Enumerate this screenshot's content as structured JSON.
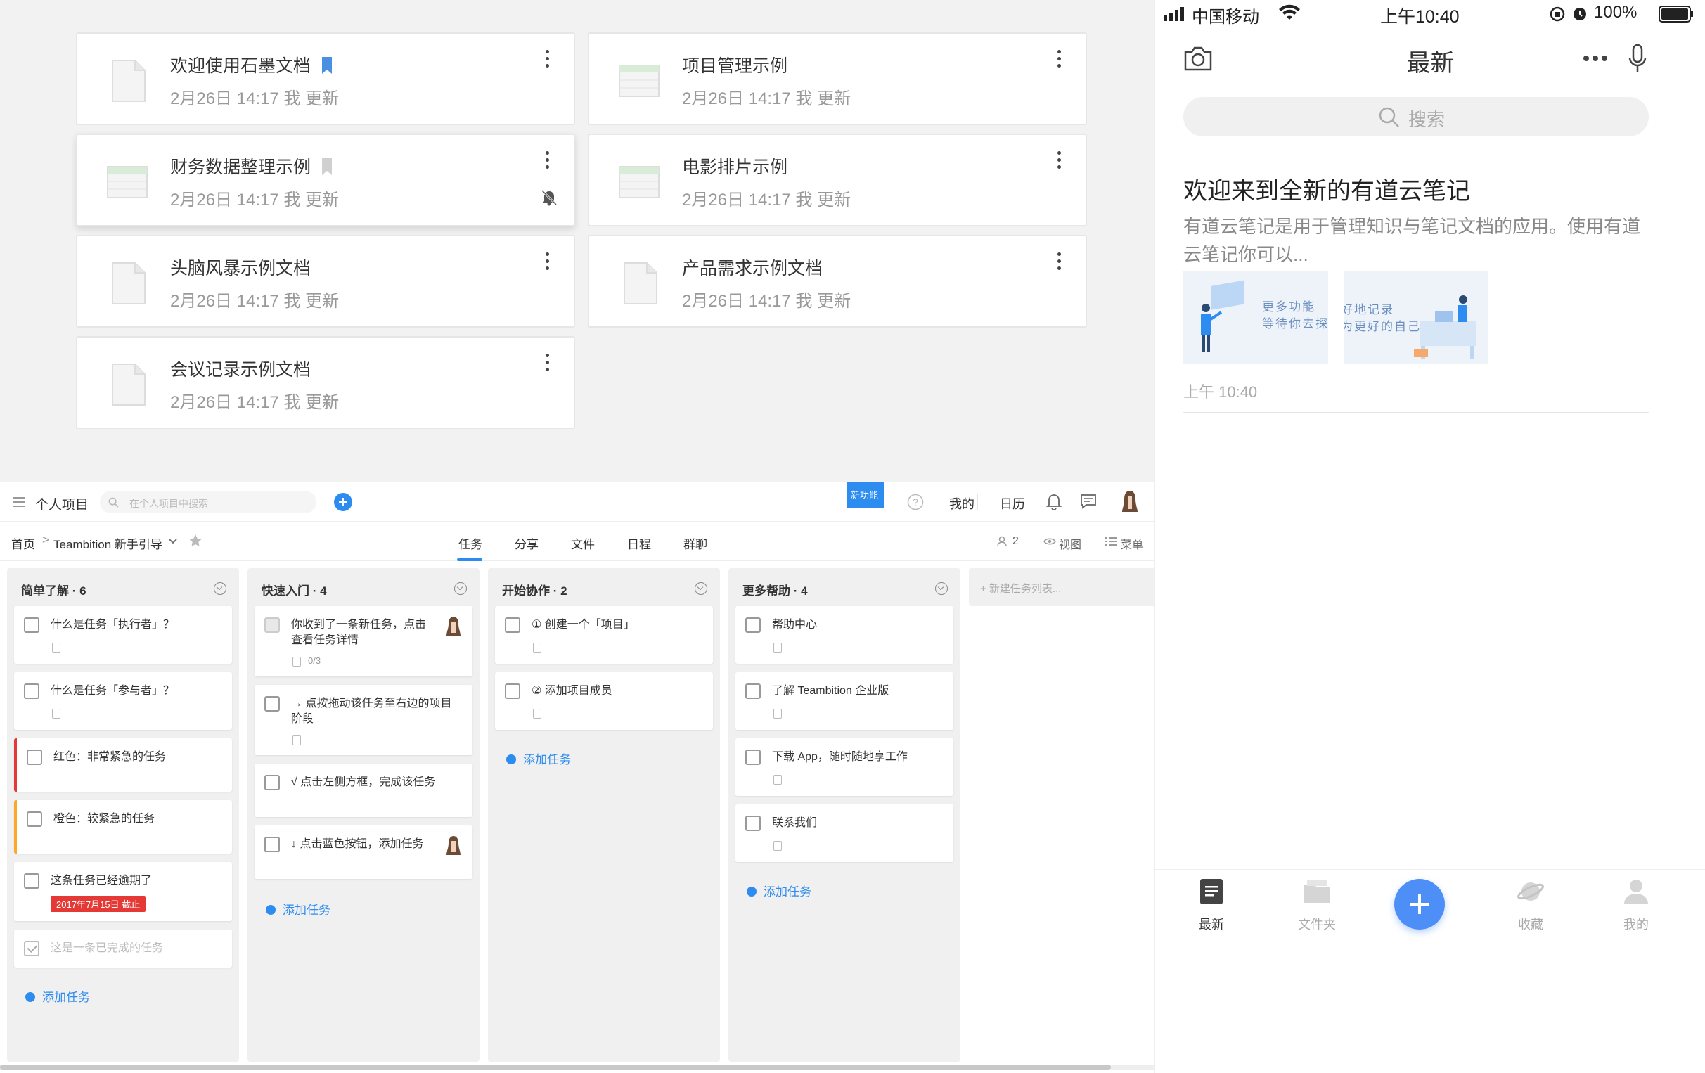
{
  "shimo": {
    "docs": [
      {
        "title": "欢迎使用石墨文档",
        "meta": "2月26日 14:17 我 更新",
        "type": "doc",
        "bookmark": "filled"
      },
      {
        "title": "项目管理示例",
        "meta": "2月26日 14:17 我 更新",
        "type": "sheet"
      },
      {
        "title": "财务数据整理示例",
        "meta": "2月26日 14:17 我 更新",
        "type": "sheet",
        "bookmark": "outline",
        "muted_bell": true
      },
      {
        "title": "电影排片示例",
        "meta": "2月26日 14:17 我 更新",
        "type": "sheet"
      },
      {
        "title": "头脑风暴示例文档",
        "meta": "2月26日 14:17 我 更新",
        "type": "doc"
      },
      {
        "title": "产品需求示例文档",
        "meta": "2月26日 14:17 我 更新",
        "type": "doc"
      },
      {
        "title": "会议记录示例文档",
        "meta": "2月26日 14:17 我 更新",
        "type": "doc"
      }
    ]
  },
  "teambition": {
    "topbar": {
      "project": "个人项目",
      "search_placeholder": "在个人项目中搜索",
      "new_badge": "新功能",
      "mine": "我的",
      "calendar": "日历"
    },
    "nav": {
      "home": "首页",
      "project_name": "Teambition 新手引导",
      "tabs": [
        "任务",
        "分享",
        "文件",
        "日程",
        "群聊"
      ],
      "members": "2",
      "view": "视图",
      "menu": "菜单"
    },
    "columns": [
      {
        "title": "简单了解 · 6",
        "cards": [
          {
            "title": "什么是任务「执行者」？"
          },
          {
            "title": "什么是任务「参与者」？"
          },
          {
            "title": "红色：非常紧急的任务"
          },
          {
            "title": "橙色：较紧急的任务"
          },
          {
            "title": "这条任务已经逾期了",
            "due": "2017年7月15日 截止"
          },
          {
            "title": "这是一条已完成的任务"
          }
        ]
      },
      {
        "title": "快速入门 · 4",
        "cards": [
          {
            "title": "你收到了一条新任务，点击查看任务详情",
            "subtasks": "0/3"
          },
          {
            "title": "→ 点按拖动该任务至右边的项目阶段"
          },
          {
            "title": "√ 点击左侧方框，完成该任务"
          },
          {
            "title": "↓ 点击蓝色按钮，添加任务"
          }
        ]
      },
      {
        "title": "开始协作 · 2",
        "cards": [
          {
            "title": "① 创建一个「项目」"
          },
          {
            "title": "② 添加项目成员"
          }
        ]
      },
      {
        "title": "更多帮助 · 4",
        "cards": [
          {
            "title": "帮助中心"
          },
          {
            "title": "了解 Teambition 企业版"
          },
          {
            "title": "下载 App，随时随地享工作"
          },
          {
            "title": "联系我们"
          }
        ]
      }
    ],
    "add_task": "添加任务",
    "new_list": "+ 新建任务列表..."
  },
  "phone": {
    "status": {
      "carrier": "中国移动",
      "time": "上午10:40",
      "battery": "100%"
    },
    "header_title": "最新",
    "search_placeholder": "搜索",
    "note": {
      "title": "欢迎来到全新的有道云笔记",
      "summary_line1": "有道云笔记是用于管理知识与笔记文档的应用。使用有道",
      "summary_line2": "云笔记你可以...",
      "thumb1_line1": "更多功能",
      "thumb1_line2": "等待你去探",
      "thumb2_line1": "好地记录",
      "thumb2_line2": "为更好的自己",
      "time": "上午 10:40"
    },
    "tabs": [
      "最新",
      "文件夹",
      "收藏",
      "我的"
    ],
    "colors": {
      "accent": "#4d8ef7"
    }
  }
}
